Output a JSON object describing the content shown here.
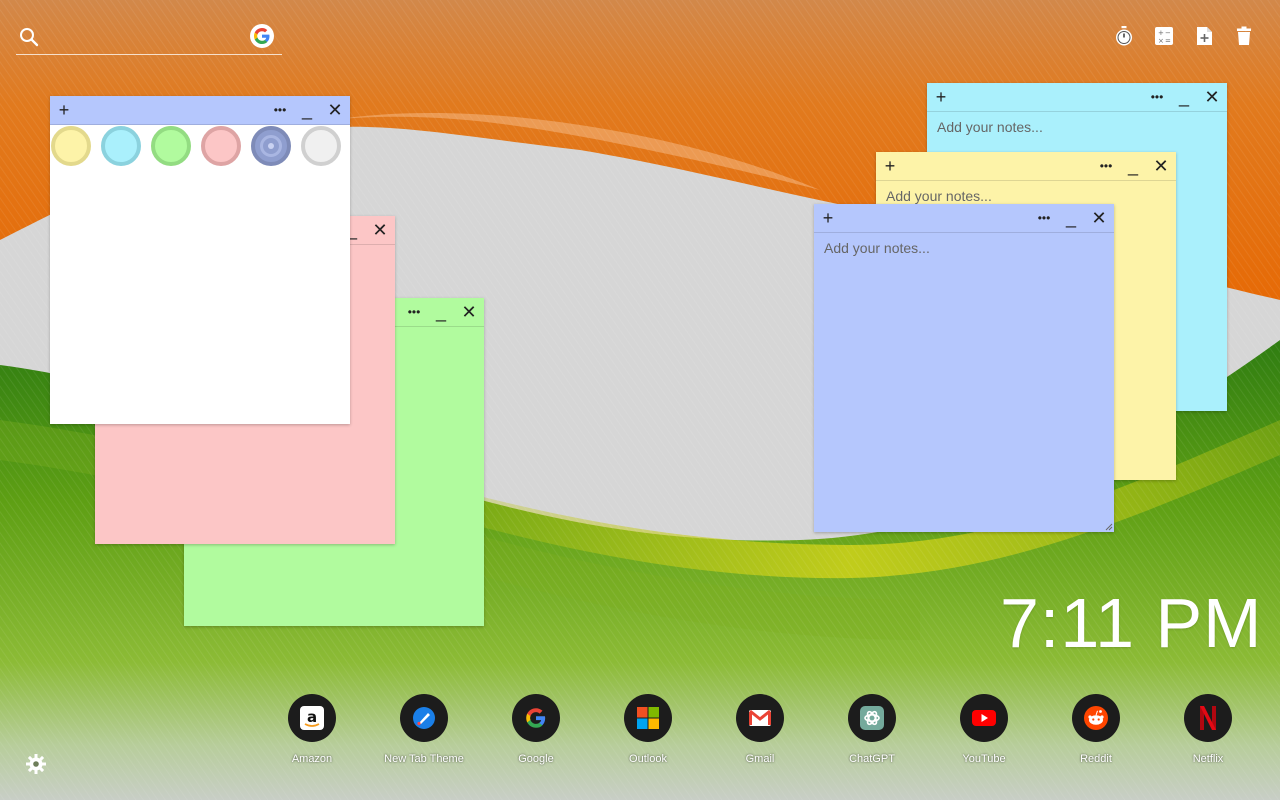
{
  "search": {
    "value": "",
    "placeholder": ""
  },
  "toolbar": {
    "tools": [
      {
        "icon": "stopwatch-icon"
      },
      {
        "icon": "calculator-icon"
      },
      {
        "icon": "add-note-icon"
      },
      {
        "icon": "trash-icon"
      }
    ]
  },
  "note_controls": {
    "add": "+",
    "more": "•••",
    "minimize": "_",
    "close": "✕"
  },
  "notes": {
    "cyan": {
      "placeholder": "Add your notes...",
      "color": "#aaf0fc"
    },
    "yellow": {
      "placeholder": "Add your notes...",
      "color": "#fdf3a8"
    },
    "blue": {
      "placeholder": "Add your notes...",
      "color": "#b5c7fd"
    },
    "pink": {
      "color": "#fcc6c6"
    },
    "green": {
      "color": "#b1fb9e"
    },
    "white": {
      "color": "#ffffff",
      "header_color": "#b5c7fd"
    }
  },
  "color_options": [
    {
      "name": "yellow",
      "fill": "#fdf3a8",
      "ring": "#e3d98c"
    },
    {
      "name": "cyan",
      "fill": "#aaf0fc",
      "ring": "#8bd2de"
    },
    {
      "name": "green",
      "fill": "#b1fb9e",
      "ring": "#93dc82"
    },
    {
      "name": "pink",
      "fill": "#fcc6c6",
      "ring": "#dea4a4"
    },
    {
      "name": "blue",
      "fill": "#8f9ecf",
      "ring": "#7e8bb8",
      "selected": true
    },
    {
      "name": "white",
      "fill": "#f0f0f0",
      "ring": "#d0d0d0"
    }
  ],
  "clock": {
    "time": "7:11 PM"
  },
  "shortcuts": [
    {
      "label": "Amazon",
      "icon": "amazon-icon"
    },
    {
      "label": "New Tab Theme",
      "icon": "new-tab-theme-icon"
    },
    {
      "label": "Google",
      "icon": "google-icon"
    },
    {
      "label": "Outlook",
      "icon": "outlook-icon"
    },
    {
      "label": "Gmail",
      "icon": "gmail-icon"
    },
    {
      "label": "ChatGPT",
      "icon": "chatgpt-icon"
    },
    {
      "label": "YouTube",
      "icon": "youtube-icon"
    },
    {
      "label": "Reddit",
      "icon": "reddit-icon"
    },
    {
      "label": "Netflix",
      "icon": "netflix-icon"
    }
  ],
  "settings": {
    "icon": "gear-icon"
  }
}
